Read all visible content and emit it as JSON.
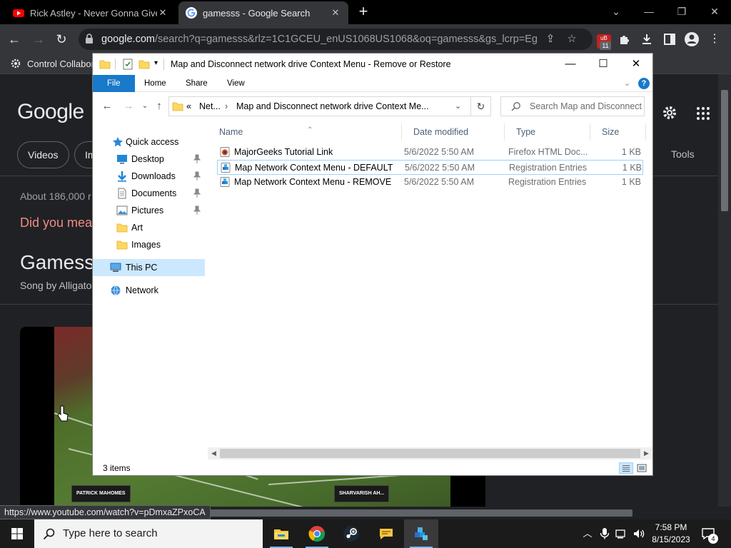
{
  "chrome": {
    "tabs": [
      {
        "label": "Rick Astley - Never Gonna Give You Up",
        "active": false,
        "favicon": "youtube-icon"
      },
      {
        "label": "gamesss - Google Search",
        "active": true,
        "favicon": "google-icon"
      }
    ],
    "url_host": "google.com",
    "url_path": "/search?q=gamesss&rlz=1C1GCEU_enUS1068US1068&oq=gamesss&gs_lcrp=EgZja...",
    "extension_badge": "11",
    "bookmark": "Control Collabora...",
    "status_url": "https://www.youtube.com/watch?v=pDmxaZPxoCA"
  },
  "google": {
    "logo": "Google",
    "chips": [
      "Videos",
      "Im"
    ],
    "tools": "Tools",
    "about": "About 186,000 r",
    "did_you_mean": "Did you mea",
    "entity_title": "Gamess",
    "entity_subtitle": "Song by Alligato",
    "video_hud_left": "PATRICK MAHOMES",
    "video_hud_right": "SHARVARISH AH..."
  },
  "explorer": {
    "title": "Map and Disconnect network drive Context Menu - Remove or Restore",
    "ribbon_tabs": [
      "File",
      "Home",
      "Share",
      "View"
    ],
    "breadcrumb": [
      "«",
      "Net...",
      "›",
      "Map and Disconnect network drive Context Me..."
    ],
    "search_placeholder": "Search Map and Disconnect ...",
    "nav": [
      {
        "label": "Quick access",
        "icon": "star-icon"
      },
      {
        "label": "Desktop",
        "icon": "desktop-icon",
        "pinned": true
      },
      {
        "label": "Downloads",
        "icon": "download-icon",
        "pinned": true
      },
      {
        "label": "Documents",
        "icon": "document-icon",
        "pinned": true
      },
      {
        "label": "Pictures",
        "icon": "picture-icon",
        "pinned": true
      },
      {
        "label": "Art",
        "icon": "folder-icon"
      },
      {
        "label": "Images",
        "icon": "folder-icon"
      },
      {
        "label": "This PC",
        "icon": "computer-icon",
        "selected": true
      },
      {
        "label": "Network",
        "icon": "network-icon"
      }
    ],
    "columns": [
      "Name",
      "Date modified",
      "Type",
      "Size"
    ],
    "files": [
      {
        "name": "MajorGeeks Tutorial Link",
        "date": "5/6/2022 5:50 AM",
        "type": "Firefox HTML Doc...",
        "size": "1 KB",
        "icon": "firefox-html-icon"
      },
      {
        "name": "Map Network Context Menu - DEFAULT",
        "date": "5/6/2022 5:50 AM",
        "type": "Registration Entries",
        "size": "1 KB",
        "icon": "registry-file-icon"
      },
      {
        "name": "Map Network Context Menu - REMOVE",
        "date": "5/6/2022 5:50 AM",
        "type": "Registration Entries",
        "size": "1 KB",
        "icon": "registry-file-icon"
      }
    ],
    "item_count": "3 items"
  },
  "taskbar": {
    "search_placeholder": "Type here to search",
    "time": "7:58 PM",
    "date": "8/15/2023",
    "notification_count": "4"
  }
}
